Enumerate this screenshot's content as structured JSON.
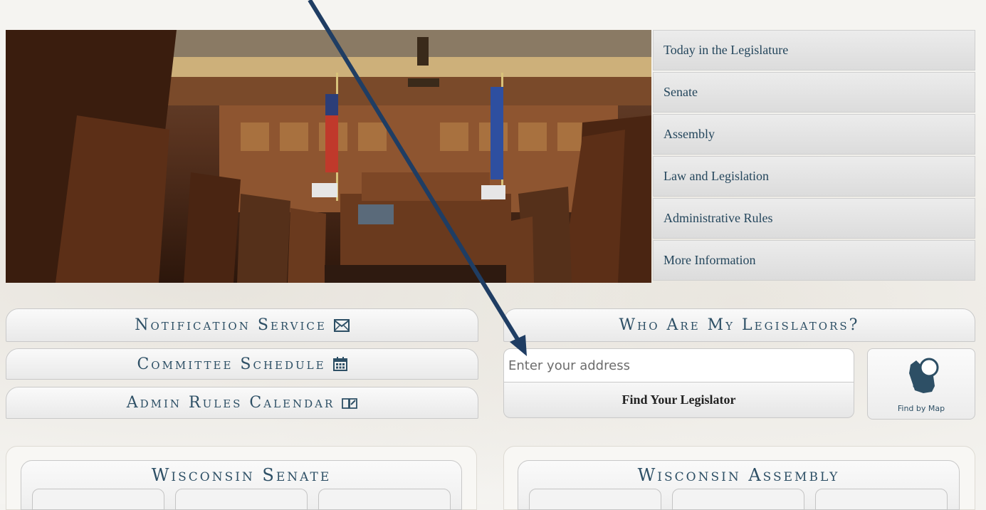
{
  "nav": {
    "items": [
      {
        "label": "Today in the Legislature"
      },
      {
        "label": "Senate"
      },
      {
        "label": "Assembly"
      },
      {
        "label": "Law and Legislation"
      },
      {
        "label": "Administrative Rules"
      },
      {
        "label": "More Information"
      }
    ]
  },
  "quick_links": {
    "notification_service": "Notification Service",
    "committee_schedule": "Committee Schedule",
    "admin_rules_calendar": "Admin Rules Calendar"
  },
  "legislator_lookup": {
    "heading": "Who Are My Legislators?",
    "address_placeholder": "Enter your address",
    "address_value": "",
    "find_button": "Find Your Legislator",
    "map_button": "Find by Map"
  },
  "panels": {
    "senate_title": "Wisconsin Senate",
    "assembly_title": "Wisconsin Assembly"
  },
  "colors": {
    "text_navy": "#2d4f65",
    "arrow": "#1f3d63",
    "nav_bg": "#e3e3e3"
  },
  "icons": {
    "notification": "envelope-icon",
    "schedule": "calendar-icon",
    "admin_calendar": "book-calendar-icon",
    "map": "wisconsin-magnifier-icon"
  }
}
